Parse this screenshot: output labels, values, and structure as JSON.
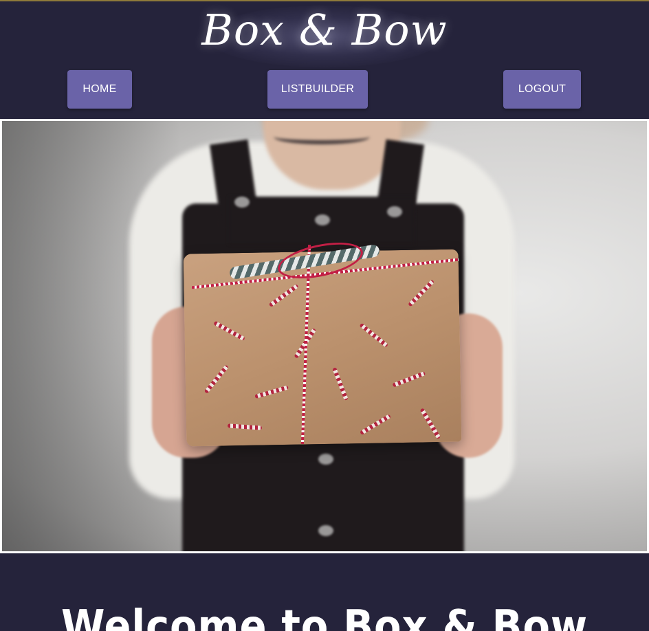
{
  "header": {
    "logo_text": "Box & Bow",
    "nav": [
      {
        "label": "HOME"
      },
      {
        "label": "LISTBUILDER"
      },
      {
        "label": "LOGOUT"
      }
    ]
  },
  "hero": {
    "image_subject": "gift-box-photo"
  },
  "main": {
    "welcome_heading": "Welcome to Box & Bow"
  },
  "colors": {
    "background": "#25233b",
    "nav_button": "#6a63a8",
    "text": "#ffffff"
  }
}
